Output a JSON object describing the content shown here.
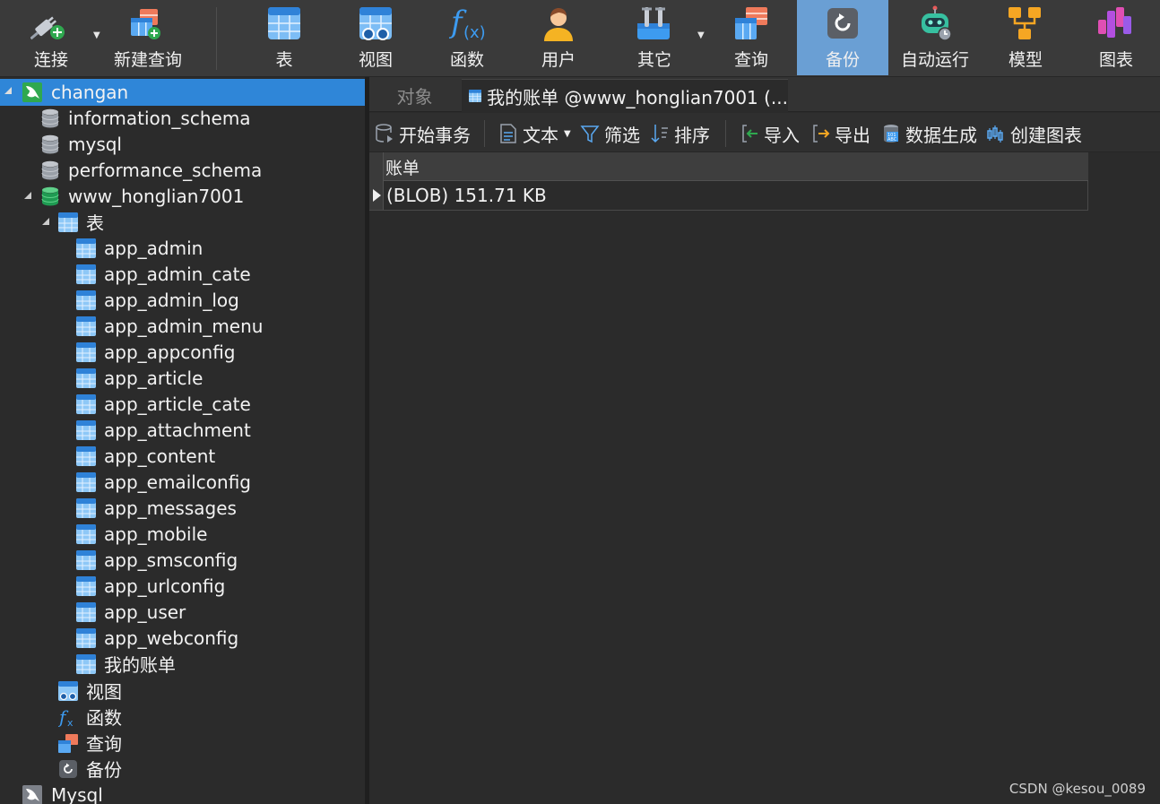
{
  "toolbar": {
    "items": [
      {
        "label": "连接",
        "icon": "connect-plug-icon"
      },
      {
        "label": "新建查询",
        "icon": "new-query-icon"
      },
      {
        "label": "表",
        "icon": "table-icon"
      },
      {
        "label": "视图",
        "icon": "view-icon"
      },
      {
        "label": "函数",
        "icon": "function-icon"
      },
      {
        "label": "用户",
        "icon": "user-icon"
      },
      {
        "label": "其它",
        "icon": "tools-icon"
      },
      {
        "label": "查询",
        "icon": "query-icon"
      },
      {
        "label": "备份",
        "icon": "backup-icon",
        "active": true
      },
      {
        "label": "自动运行",
        "icon": "robot-icon"
      },
      {
        "label": "模型",
        "icon": "model-icon"
      },
      {
        "label": "图表",
        "icon": "chart-icon"
      }
    ]
  },
  "sidebar": {
    "connection": "changan",
    "databases": [
      "information_schema",
      "mysql",
      "performance_schema",
      "www_honglian7001"
    ],
    "tables_group": "表",
    "tables": [
      "app_admin",
      "app_admin_cate",
      "app_admin_log",
      "app_admin_menu",
      "app_appconfig",
      "app_article",
      "app_article_cate",
      "app_attachment",
      "app_content",
      "app_emailconfig",
      "app_messages",
      "app_mobile",
      "app_smsconfig",
      "app_urlconfig",
      "app_user",
      "app_webconfig",
      "我的账单"
    ],
    "groups": [
      "视图",
      "函数",
      "查询",
      "备份"
    ],
    "other_connection": "Mysql"
  },
  "tabs": {
    "objects": "对象",
    "query": "我的账单 @www_honglian7001 (..."
  },
  "subtoolbar": {
    "begin_transaction": "开始事务",
    "text": "文本",
    "filter": "筛选",
    "sort": "排序",
    "import": "导入",
    "export": "导出",
    "data_generation": "数据生成",
    "create_chart": "创建图表"
  },
  "grid": {
    "column": "账单",
    "rows": [
      "(BLOB) 151.71 KB"
    ]
  },
  "watermark": "CSDN @kesou_0089",
  "colors": {
    "selection": "#2f86d8",
    "active_toolbar": "#6a9fd4",
    "background": "#2b2b2b"
  }
}
